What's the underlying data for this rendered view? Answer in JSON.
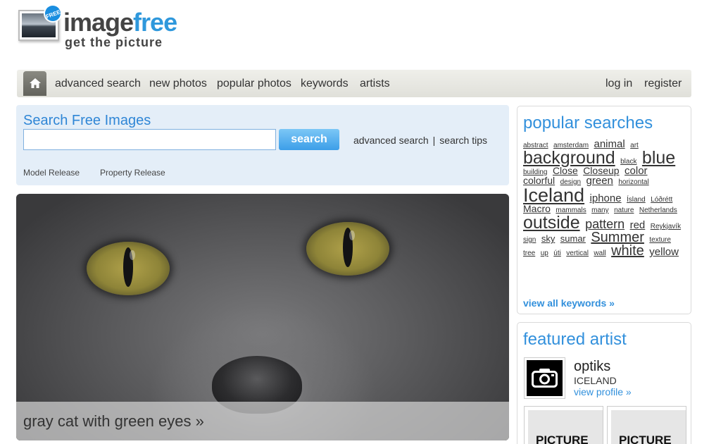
{
  "logo": {
    "badge": "FREE",
    "name_part1": "image",
    "name_part2": "free",
    "tagline": "get the picture"
  },
  "nav": {
    "home_icon": "home-icon",
    "links": [
      "advanced search",
      "new photos",
      "popular photos",
      "keywords",
      "artists"
    ],
    "login": "log in",
    "register": "register"
  },
  "search": {
    "title": "Search Free Images",
    "input_value": "",
    "button": "search",
    "advanced_link": "advanced search",
    "separator": "|",
    "tips_link": "search tips",
    "checkbox_model": "Model Release",
    "checkbox_property": "Property Release"
  },
  "hero": {
    "caption": "gray cat with green eyes »"
  },
  "popular": {
    "title": "popular searches",
    "tags": [
      {
        "t": "abstract",
        "s": 10
      },
      {
        "t": "amsterdam",
        "s": 10
      },
      {
        "t": "animal",
        "s": 15
      },
      {
        "t": "art",
        "s": 10
      },
      {
        "t": "background",
        "s": 25
      },
      {
        "t": "black",
        "s": 10
      },
      {
        "t": "blue",
        "s": 25
      },
      {
        "t": "building",
        "s": 10
      },
      {
        "t": "Close",
        "s": 14
      },
      {
        "t": "Closeup",
        "s": 14
      },
      {
        "t": "color",
        "s": 15
      },
      {
        "t": "colorful",
        "s": 14
      },
      {
        "t": "design",
        "s": 10
      },
      {
        "t": "green",
        "s": 15
      },
      {
        "t": "horizontal",
        "s": 10
      },
      {
        "t": "Iceland",
        "s": 27
      },
      {
        "t": "iphone",
        "s": 15
      },
      {
        "t": "Ísland",
        "s": 10
      },
      {
        "t": "Lóðrétt",
        "s": 10
      },
      {
        "t": "Macro",
        "s": 14
      },
      {
        "t": "mammals",
        "s": 10
      },
      {
        "t": "many",
        "s": 10
      },
      {
        "t": "nature",
        "s": 10
      },
      {
        "t": "Netherlands",
        "s": 10
      },
      {
        "t": "outside",
        "s": 25
      },
      {
        "t": "pattern",
        "s": 18
      },
      {
        "t": "red",
        "s": 15
      },
      {
        "t": "Reykjavík",
        "s": 10
      },
      {
        "t": "sign",
        "s": 10
      },
      {
        "t": "sky",
        "s": 13
      },
      {
        "t": "sumar",
        "s": 13
      },
      {
        "t": "Summer",
        "s": 20
      },
      {
        "t": "texture",
        "s": 10
      },
      {
        "t": "tree",
        "s": 10
      },
      {
        "t": "up",
        "s": 10
      },
      {
        "t": "úti",
        "s": 10
      },
      {
        "t": "vertical",
        "s": 10
      },
      {
        "t": "wall",
        "s": 10
      },
      {
        "t": "white",
        "s": 20
      },
      {
        "t": "yellow",
        "s": 15
      }
    ],
    "view_all": "view all keywords »"
  },
  "featured": {
    "title": "featured artist",
    "avatar_icon": "camera-icon",
    "name": "optiks",
    "country": "ICELAND",
    "profile_link": "view profile »",
    "thumb_label_1": "PICTURE",
    "thumb_label_2": "PICTURE"
  },
  "colors": {
    "accent": "#3290dc",
    "nav_bg": "#e6e6e0",
    "search_bg": "#e4eef8",
    "search_button": "#4aa6ec"
  }
}
